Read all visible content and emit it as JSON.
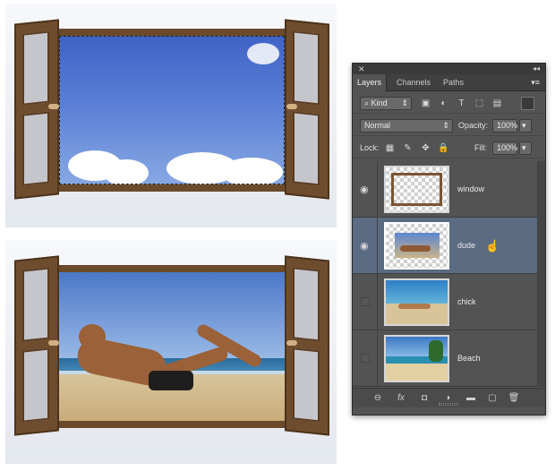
{
  "panel": {
    "tabs": [
      "Layers",
      "Channels",
      "Paths"
    ],
    "filter_kind": "Kind",
    "blend_mode": "Normal",
    "opacity_label": "Opacity:",
    "opacity_value": "100%",
    "lock_label": "Lock:",
    "fill_label": "Fill:",
    "fill_value": "100%",
    "layers": [
      {
        "name": "window",
        "visible": true,
        "selected": false
      },
      {
        "name": "dude",
        "visible": true,
        "selected": true
      },
      {
        "name": "chick",
        "visible": false,
        "selected": false
      },
      {
        "name": "Beach",
        "visible": false,
        "selected": false
      }
    ],
    "footer_icons": [
      "link-icon",
      "fx-icon",
      "mask-icon",
      "adjustment-icon",
      "group-folder-icon",
      "new-layer-icon",
      "trash-icon"
    ],
    "colors": {
      "panel": "#535353",
      "selected_layer": "#5a6b82"
    }
  }
}
